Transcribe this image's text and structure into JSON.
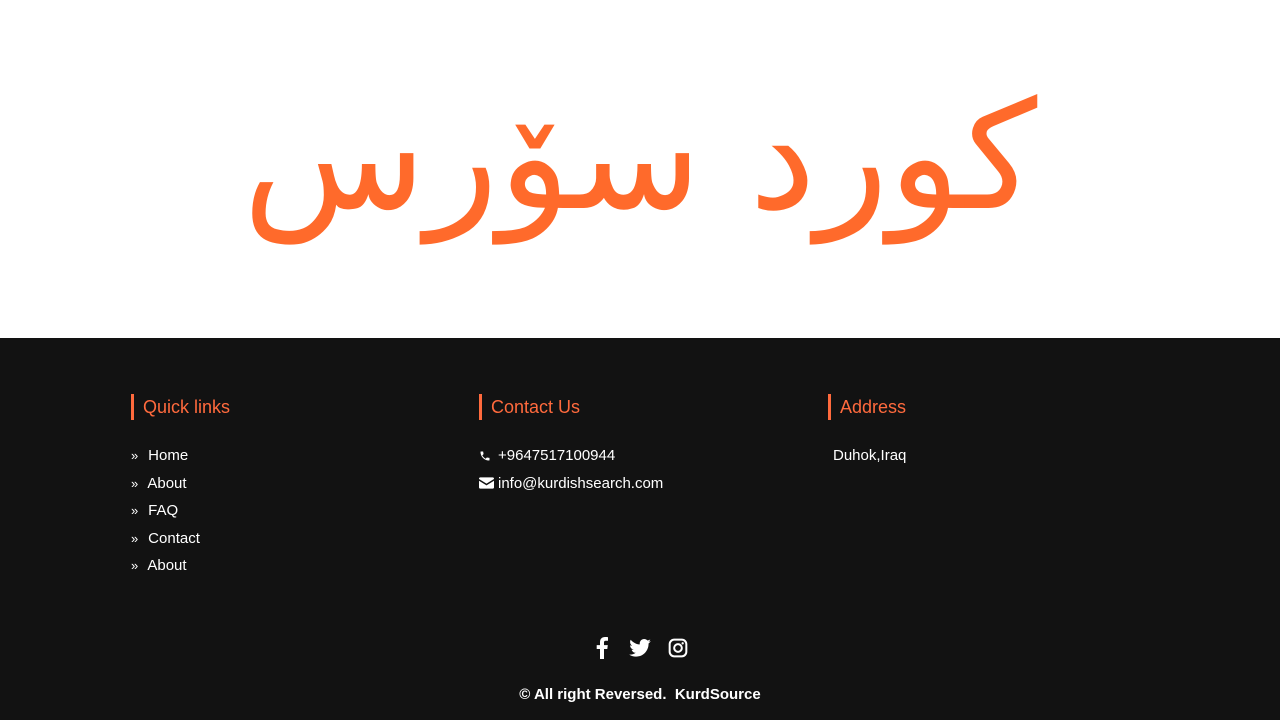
{
  "hero": {
    "logo_text": "كورد سۆرس",
    "accent_color": "#ff6a2b"
  },
  "footer": {
    "background": "#121212",
    "quick_links": {
      "title": "Quick links",
      "items": [
        {
          "label": "Home",
          "icon": "double-chevron-right-icon"
        },
        {
          "label": "About",
          "icon": "double-chevron-right-icon"
        },
        {
          "label": "FAQ",
          "icon": "double-chevron-right-icon"
        },
        {
          "label": "Contact",
          "icon": "double-chevron-right-icon"
        },
        {
          "label": "About",
          "icon": "double-chevron-right-icon"
        }
      ]
    },
    "contact": {
      "title": "Contact Us",
      "phone": "+9647517100944",
      "email": "info@kurdishsearch.com"
    },
    "address": {
      "title": "Address",
      "text": "Duhok,Iraq"
    },
    "social": [
      "facebook-icon",
      "twitter-icon",
      "instagram-icon"
    ],
    "copyright": "© All right Reversed.  KurdSource"
  }
}
